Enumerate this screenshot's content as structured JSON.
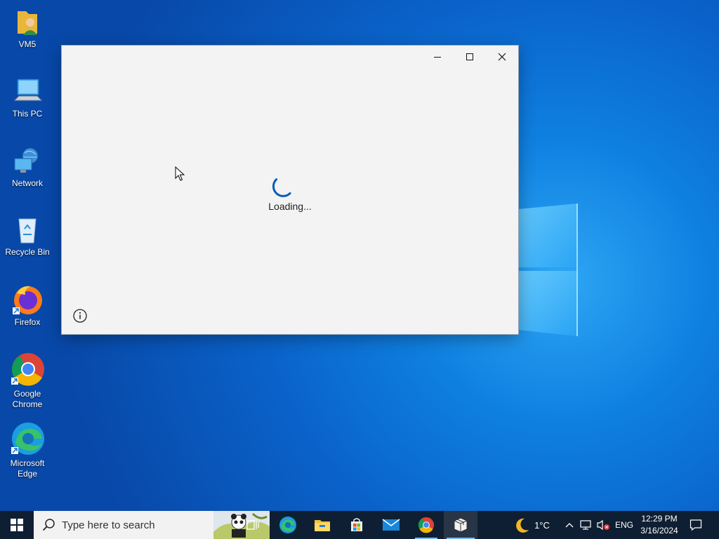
{
  "desktop": {
    "icons": [
      {
        "label": "VM5"
      },
      {
        "label": "This PC"
      },
      {
        "label": "Network"
      },
      {
        "label": "Recycle Bin"
      },
      {
        "label": "Firefox"
      },
      {
        "label": "Google Chrome"
      },
      {
        "label": "Microsoft Edge"
      }
    ]
  },
  "window": {
    "loading_text": "Loading...",
    "buttons": {
      "minimize": "minimize-icon",
      "maximize": "maximize-icon",
      "close": "close-icon",
      "info": "info-icon"
    }
  },
  "taskbar": {
    "search_placeholder": "Type here to search",
    "apps": [
      "task-view-icon",
      "edge-icon",
      "file-explorer-icon",
      "store-icon",
      "mail-icon",
      "chrome-icon",
      "package-app-icon"
    ],
    "weather": {
      "temperature": "1°C",
      "icon": "moon-icon"
    },
    "language": "ENG",
    "time": "12:29 PM",
    "date": "3/16/2024"
  },
  "colors": {
    "taskbar": "#0f1f33",
    "spinner": "#0a5cb8",
    "window_bg": "#f3f3f3"
  }
}
